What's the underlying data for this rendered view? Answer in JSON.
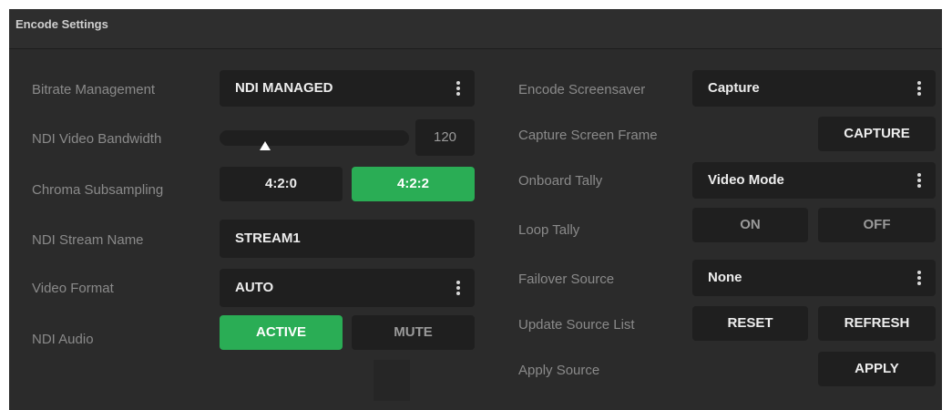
{
  "panel": {
    "title": "Encode Settings"
  },
  "left": {
    "bitrate": {
      "label": "Bitrate Management",
      "value": "NDI MANAGED"
    },
    "bandwidth": {
      "label": "NDI Video Bandwidth",
      "value": "120",
      "slider_fraction": 0.24
    },
    "chroma": {
      "label": "Chroma Subsampling",
      "options": [
        "4:2:0",
        "4:2:2"
      ],
      "selected": "4:2:2"
    },
    "stream": {
      "label": "NDI Stream Name",
      "value": "STREAM1"
    },
    "format": {
      "label": "Video Format",
      "value": "AUTO"
    },
    "audio": {
      "label": "NDI Audio",
      "options": [
        "ACTIVE",
        "MUTE"
      ],
      "selected": "ACTIVE"
    }
  },
  "right": {
    "screensaver": {
      "label": "Encode Screensaver",
      "value": "Capture"
    },
    "capture_frame": {
      "label": "Capture Screen Frame",
      "button": "CAPTURE"
    },
    "onboard_tally": {
      "label": "Onboard Tally",
      "value": "Video Mode"
    },
    "loop_tally": {
      "label": "Loop Tally",
      "options": [
        "ON",
        "OFF"
      ]
    },
    "failover": {
      "label": "Failover Source",
      "value": "None"
    },
    "update_list": {
      "label": "Update Source List",
      "buttons": [
        "RESET",
        "REFRESH"
      ]
    },
    "apply": {
      "label": "Apply Source",
      "button": "APPLY"
    }
  },
  "colors": {
    "panel_bg": "#2b2b2b",
    "control_bg": "#1f1f1f",
    "active_green": "#2aad55",
    "label_text": "#8a8a8a"
  },
  "icons": {
    "menu": "kebab-menu-icon",
    "slider": "triangle-thumb-icon"
  }
}
